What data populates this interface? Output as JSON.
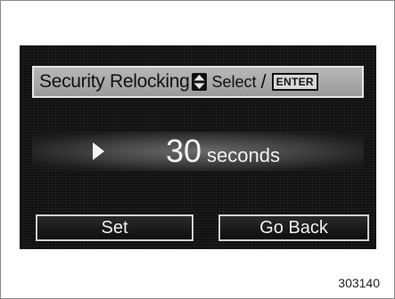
{
  "screen": {
    "title": "Security Relocking",
    "updown_icon": "up-down-arrow-icon",
    "select_label": "Select",
    "slash": "/",
    "enter_label": "ENTER",
    "value": "30",
    "unit": "seconds",
    "buttons": {
      "set_label": "Set",
      "back_label": "Go Back"
    }
  },
  "figure_number": "303140"
}
